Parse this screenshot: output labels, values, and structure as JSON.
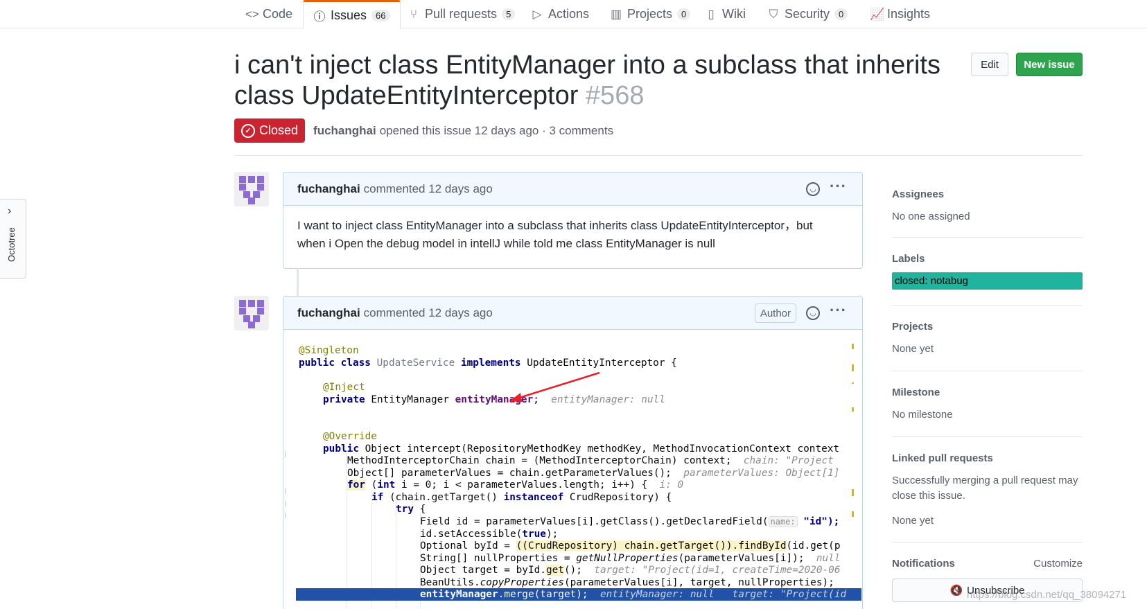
{
  "repo_nav": {
    "tabs": [
      {
        "label": "Code",
        "icon": "code-icon"
      },
      {
        "label": "Issues",
        "icon": "issue-opened-icon",
        "count": "66",
        "selected": true
      },
      {
        "label": "Pull requests",
        "icon": "git-pull-request-icon",
        "count": "5"
      },
      {
        "label": "Actions",
        "icon": "play-icon"
      },
      {
        "label": "Projects",
        "icon": "project-icon",
        "count": "0"
      },
      {
        "label": "Wiki",
        "icon": "book-icon"
      },
      {
        "label": "Security",
        "icon": "shield-icon",
        "count": "0"
      },
      {
        "label": "Insights",
        "icon": "graph-icon"
      }
    ]
  },
  "octotree": {
    "label": "Octotree"
  },
  "issue": {
    "title_line1": "i can't inject class EntityManager into a subclass that inherits",
    "title_line2": "class UpdateEntityInterceptor",
    "number": "#568",
    "state": "Closed",
    "author": "fuchanghai",
    "meta_text": "opened this issue 12 days ago · 3 comments",
    "edit_label": "Edit",
    "new_issue_label": "New issue"
  },
  "comments": [
    {
      "author": "fuchanghai",
      "time": "commented 12 days ago",
      "body_line1": "I want to inject class EntityManager into a subclass that inherits class UpdateEntityInterceptor，but",
      "body_line2": "when i Open the debug model in intellJ while told me class EntityManager is null"
    },
    {
      "author": "fuchanghai",
      "time": "commented 12 days ago",
      "badge": "Author"
    }
  ],
  "code": {
    "l1": "@Singleton",
    "l2a": "public class",
    "l2b": " UpdateService ",
    "l2c": "implements",
    "l2d": " UpdateEntityInterceptor {",
    "l3": "@Inject",
    "l4a": "private",
    "l4b": " EntityManager ",
    "l4c": "entityManager",
    "l4d": ";",
    "l4hint": "entityManager: null",
    "l5": "@Override",
    "l6a": "public",
    "l6b": " Object intercept(RepositoryMethodKey methodKey, MethodInvocationContext context",
    "l7a": "MethodInterceptorChain chain = (MethodInterceptorChain) context;",
    "l7hint": "chain: \"Project",
    "l8a": "Object[] parameterValues = chain.getParameterValues();",
    "l8hint": "parameterValues: Object[1]",
    "l9a": "for",
    "l9b": " (",
    "l9c": "int",
    "l9d": " i = 0; i < parameterValues.length; i++) {",
    "l9hint": "i: 0",
    "l10a": "if",
    "l10b": " (chain.getTarget() ",
    "l10c": "instanceof",
    "l10d": " CrudRepository) {",
    "l11": "try",
    "l11b": " {",
    "l12a": "Field id = parameterValues[i].getClass().getDeclaredField(",
    "l12name": "name:",
    "l12b": " \"id\");",
    "l13a": "id.setAccessible(",
    "l13b": "true",
    "l13c": ");",
    "l14a": "Optional byId = ",
    "l14b": "((CrudRepository) chain.getTarget()).findById",
    "l14c": "(id.get(p",
    "l15a": "String[] nullProperties = ",
    "l15b": "getNullProperties",
    "l15c": "(parameterValues[i]);",
    "l15hint": "null",
    "l16a": "Object target = byId.",
    "l16b": "get",
    "l16c": "();",
    "l16hint": "target: \"Project(id=1, createTime=2020-06",
    "l17a": "BeanUtils.",
    "l17b": "copyProperties",
    "l17c": "(parameterValues[i], target, nullProperties);",
    "l18a": "entityManager",
    "l18b": ".merge(target);",
    "l18hint": "entityManager: null   target: \"Project(id"
  },
  "sidebar": {
    "assignees": {
      "heading": "Assignees",
      "value": "No one assigned"
    },
    "labels": {
      "heading": "Labels",
      "value": "closed: notabug",
      "color": "#20b39e"
    },
    "projects": {
      "heading": "Projects",
      "value": "None yet"
    },
    "milestone": {
      "heading": "Milestone",
      "value": "No milestone"
    },
    "linked": {
      "heading": "Linked pull requests",
      "line1": "Successfully merging a pull request may",
      "line2": "close this issue.",
      "value": "None yet"
    },
    "notifications": {
      "heading": "Notifications",
      "customize": "Customize",
      "unsubscribe": "Unsubscribe"
    }
  },
  "watermark": "https://blog.csdn.net/qq_38094271"
}
